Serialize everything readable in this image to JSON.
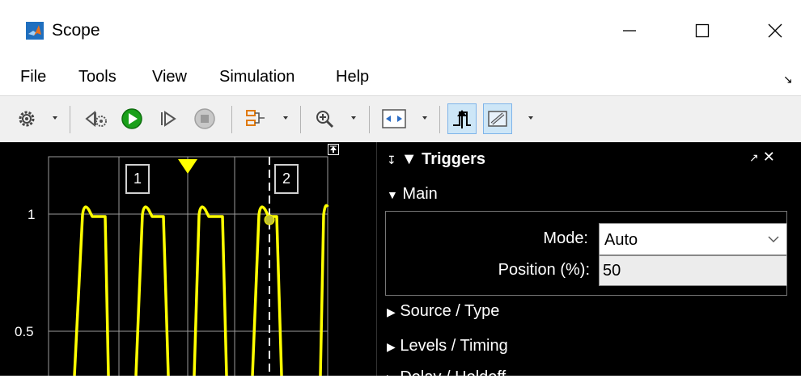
{
  "window": {
    "title": "Scope",
    "icon": "matlab-icon",
    "controls": [
      "minimize-icon",
      "maximize-icon",
      "close-icon"
    ]
  },
  "menu": {
    "items": [
      "File",
      "Tools",
      "View",
      "Simulation",
      "Help"
    ]
  },
  "toolbar": {
    "items": [
      "settings-icon",
      "step-back-icon",
      "run-icon",
      "step-forward-icon",
      "stop-icon",
      "signal-selection-icon",
      "zoom-in-icon",
      "scale-axes-icon",
      "triggers-icon",
      "measurements-icon"
    ]
  },
  "plot": {
    "y_ticks": [
      "1",
      "0.5"
    ],
    "markers": [
      "1",
      "2"
    ],
    "colors": {
      "signal": "#ffff00",
      "grid": "#9a9a9a",
      "background": "#000000"
    }
  },
  "triggers_panel": {
    "title": "Triggers",
    "main_section": "Main",
    "mode_label": "Mode:",
    "mode_value": "Auto",
    "position_label": "Position (%):",
    "position_value": "50",
    "sections": [
      "Source / Type",
      "Levels / Timing",
      "Delay / Holdoff"
    ]
  }
}
